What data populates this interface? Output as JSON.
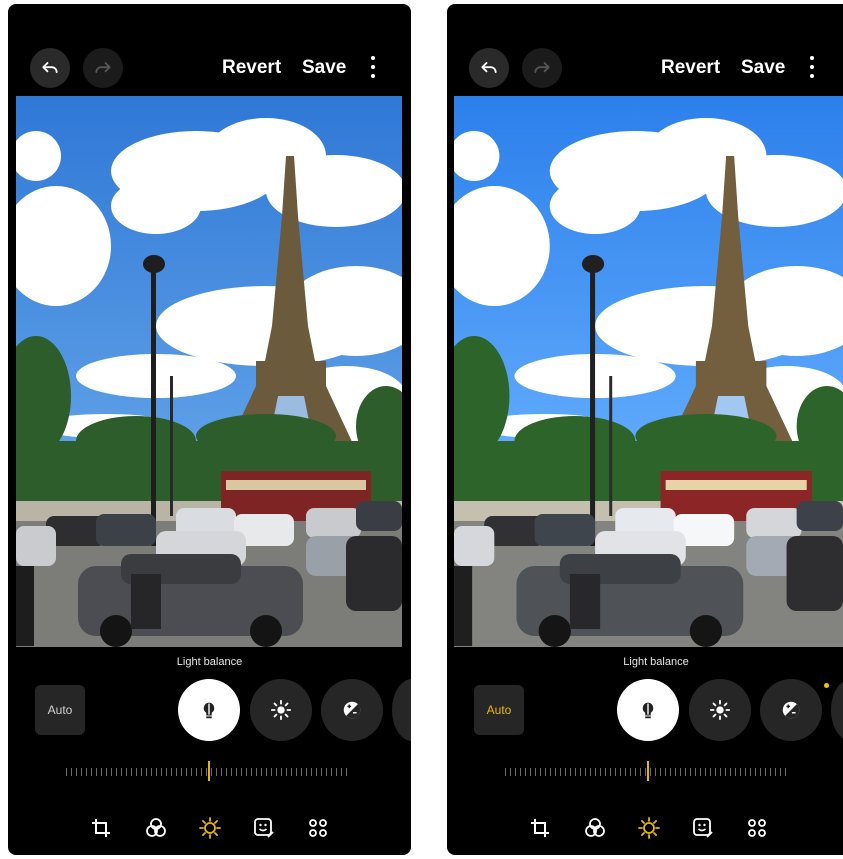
{
  "screens": [
    {
      "toolbar": {
        "revert_label": "Revert",
        "save_label": "Save"
      },
      "adjust": {
        "mode_label": "Light balance",
        "auto_label": "Auto",
        "auto_active": false,
        "slider_level": 0.5
      },
      "tools": [
        "light-balance",
        "brightness",
        "exposure"
      ],
      "nav": [
        "transform",
        "filters",
        "tone",
        "decorations",
        "more"
      ]
    },
    {
      "toolbar": {
        "revert_label": "Revert",
        "save_label": "Save"
      },
      "adjust": {
        "mode_label": "Light balance",
        "auto_label": "Auto",
        "auto_active": true,
        "slider_level": 0.5
      },
      "tools": [
        "light-balance",
        "brightness",
        "exposure"
      ],
      "nav": [
        "transform",
        "filters",
        "tone",
        "decorations",
        "more"
      ]
    }
  ],
  "colors": {
    "accent": "#e8b800",
    "background": "#000000",
    "button": "#262626"
  }
}
